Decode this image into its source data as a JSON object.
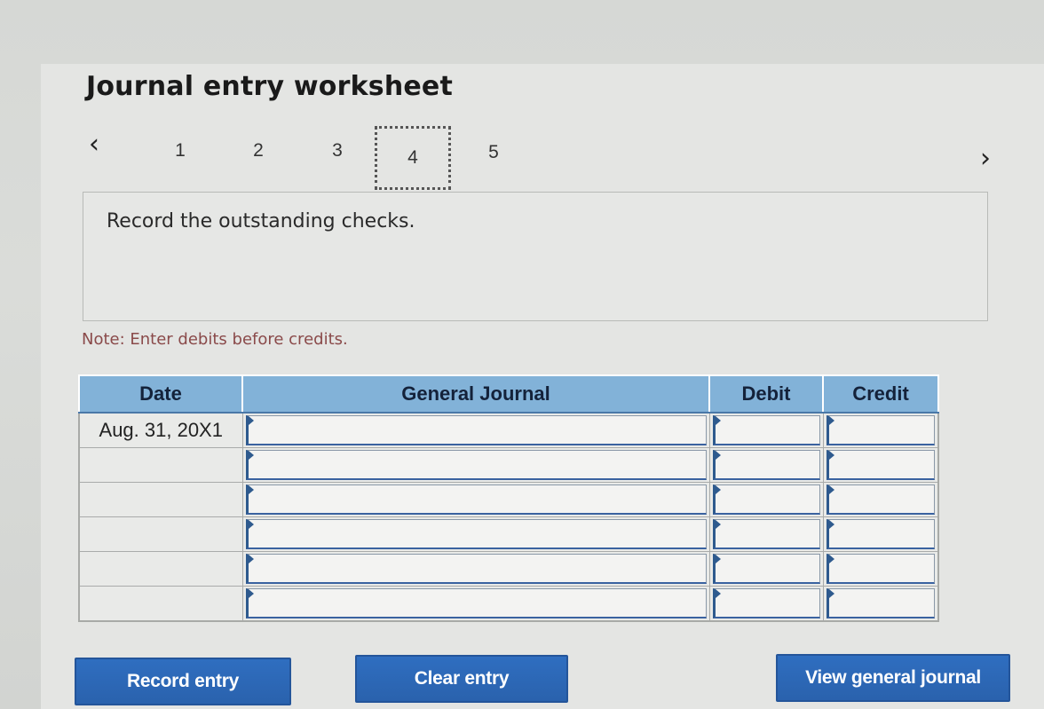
{
  "worksheet": {
    "title": "Journal entry worksheet"
  },
  "steps": {
    "prev_icon": "‹",
    "next_icon": "›",
    "items": [
      {
        "label": "1",
        "active": false
      },
      {
        "label": "2",
        "active": false
      },
      {
        "label": "3",
        "active": false
      },
      {
        "label": "4",
        "active": true
      },
      {
        "label": "5",
        "active": false
      }
    ]
  },
  "instruction": {
    "text": "Record the outstanding checks."
  },
  "note": {
    "text": "Note: Enter debits before credits."
  },
  "journal": {
    "columns": [
      "Date",
      "General Journal",
      "Debit",
      "Credit"
    ],
    "rows": [
      {
        "date": "Aug. 31, 20X1",
        "account": "",
        "debit": "",
        "credit": ""
      },
      {
        "date": "",
        "account": "",
        "debit": "",
        "credit": ""
      },
      {
        "date": "",
        "account": "",
        "debit": "",
        "credit": ""
      },
      {
        "date": "",
        "account": "",
        "debit": "",
        "credit": ""
      },
      {
        "date": "",
        "account": "",
        "debit": "",
        "credit": ""
      },
      {
        "date": "",
        "account": "",
        "debit": "",
        "credit": ""
      }
    ]
  },
  "buttons": {
    "record": "Record entry",
    "clear": "Clear entry",
    "view": "View general journal"
  },
  "colors": {
    "header_blue": "#82b2d8",
    "button_blue": "#2f6ec0",
    "note_red": "#8a4a4a"
  }
}
